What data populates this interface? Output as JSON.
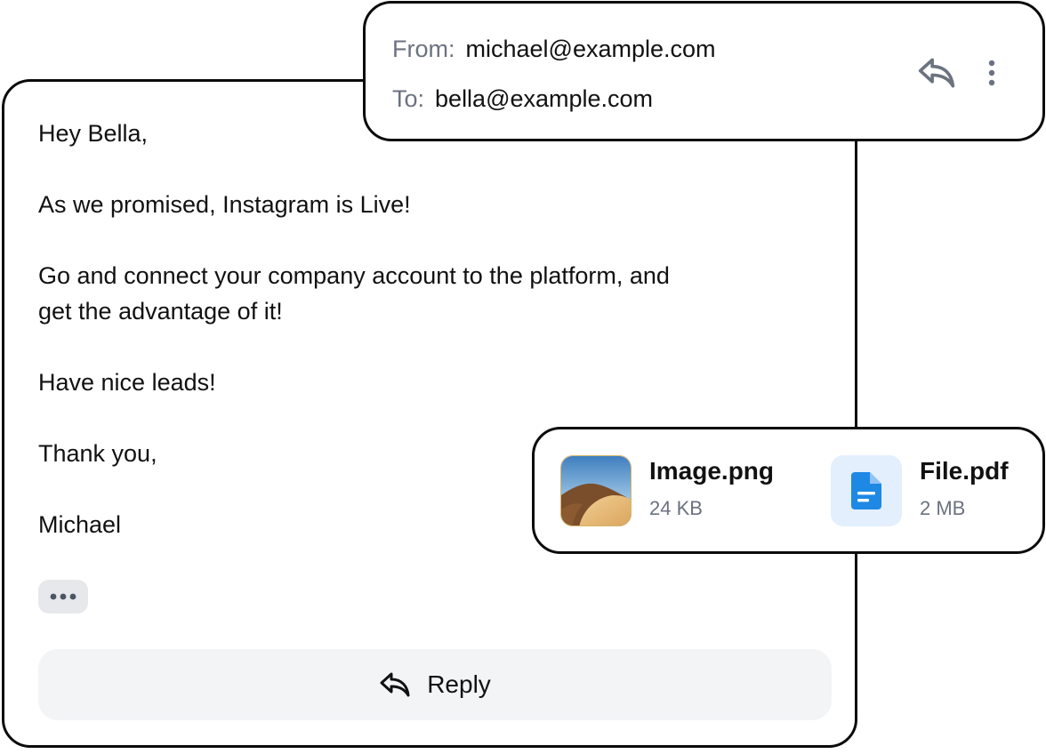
{
  "header": {
    "from_label": "From:",
    "from_value": "michael@example.com",
    "to_label": "To:",
    "to_value": "bella@example.com",
    "icons": [
      "reply-icon",
      "more-vertical-icon"
    ]
  },
  "message": {
    "greeting": "Hey Bella,",
    "line1": "As we promised, Instagram is Live!",
    "line2a": "Go and connect your company account to the platform, and",
    "line2b": "get the advantage of it!",
    "line3": "Have nice leads!",
    "closing": "Thank you,",
    "signature": "Michael",
    "more_icon": "more-horizontal-icon"
  },
  "reply_button": {
    "label": "Reply",
    "icon": "reply-icon"
  },
  "attachments": [
    {
      "name": "Image.png",
      "size": "24 KB",
      "icon": "image-thumbnail"
    },
    {
      "name": "File.pdf",
      "size": "2 MB",
      "icon": "document-icon"
    }
  ],
  "colors": {
    "border": "#0b0b0b",
    "muted_text": "#6b7280",
    "button_bg": "#f3f4f6",
    "pill_bg": "#e6e8eb",
    "file_icon_bg": "#e3effd",
    "file_icon": "#1e88e5"
  }
}
